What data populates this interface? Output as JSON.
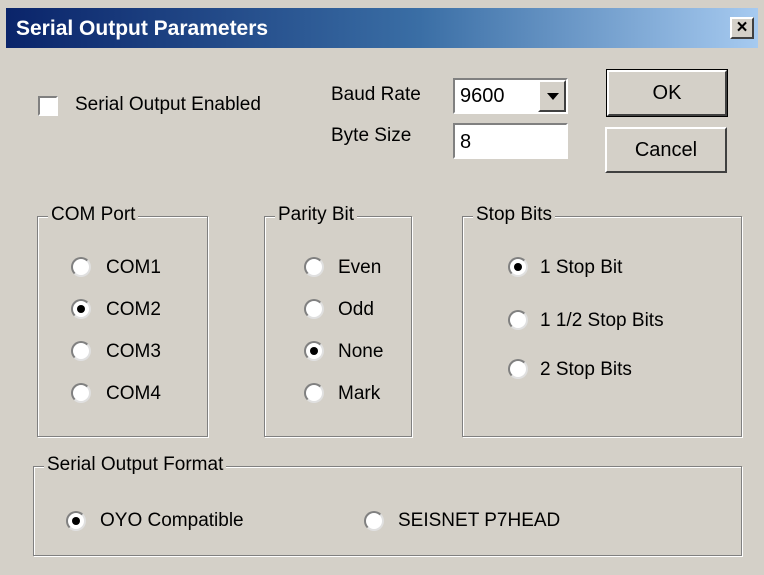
{
  "window": {
    "title": "Serial Output Parameters",
    "close_symbol": "×"
  },
  "serial_output_enabled": {
    "label": "Serial Output Enabled",
    "checked": false
  },
  "baud_rate": {
    "label": "Baud Rate",
    "value": "9600"
  },
  "byte_size": {
    "label": "Byte Size",
    "value": "8"
  },
  "buttons": {
    "ok": "OK",
    "cancel": "Cancel"
  },
  "com_port": {
    "legend": "COM Port",
    "options": [
      "COM1",
      "COM2",
      "COM3",
      "COM4"
    ],
    "selected": "COM2"
  },
  "parity_bit": {
    "legend": "Parity Bit",
    "options": [
      "Even",
      "Odd",
      "None",
      "Mark"
    ],
    "selected": "None"
  },
  "stop_bits": {
    "legend": "Stop Bits",
    "options": [
      "1 Stop Bit",
      "1 1/2 Stop Bits",
      "2 Stop Bits"
    ],
    "selected": "1 Stop Bit"
  },
  "serial_output_format": {
    "legend": "Serial Output Format",
    "options": [
      "OYO Compatible",
      "SEISNET P7HEAD"
    ],
    "selected": "OYO Compatible"
  }
}
